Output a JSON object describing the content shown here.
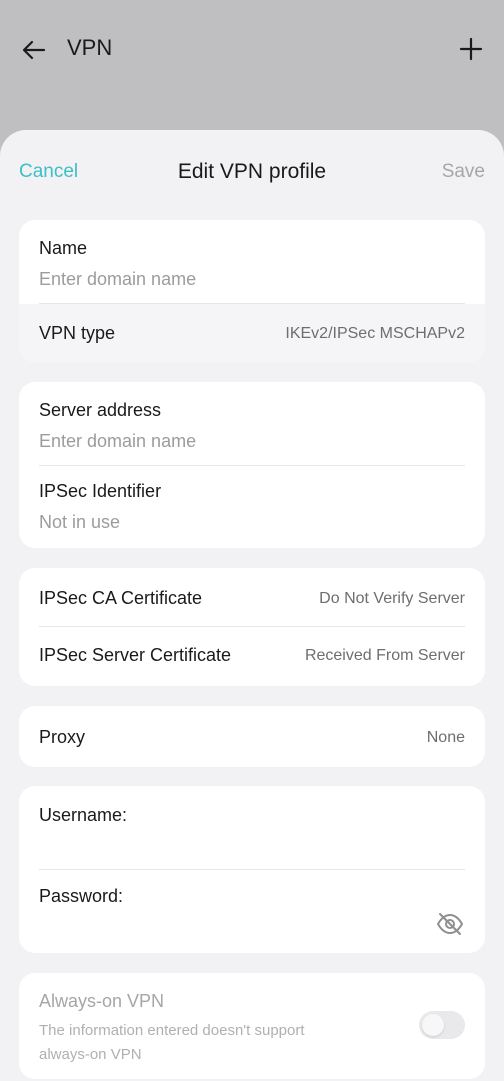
{
  "topbar": {
    "title": "VPN"
  },
  "sheet": {
    "cancel": "Cancel",
    "title": "Edit VPN profile",
    "save": "Save"
  },
  "profile": {
    "name_label": "Name",
    "name_placeholder": "Enter domain name",
    "vpn_type_label": "VPN type",
    "vpn_type_value": "IKEv2/IPSec MSCHAPv2"
  },
  "server": {
    "address_label": "Server address",
    "address_placeholder": "Enter domain name",
    "identifier_label": "IPSec Identifier",
    "identifier_placeholder": "Not in use"
  },
  "certificates": {
    "ca_label": "IPSec CA Certificate",
    "ca_value": "Do Not Verify Server",
    "server_label": "IPSec Server Certificate",
    "server_value": "Received From Server"
  },
  "proxy": {
    "label": "Proxy",
    "value": "None"
  },
  "credentials": {
    "username_label": "Username:",
    "password_label": "Password:"
  },
  "always_on": {
    "label": "Always-on VPN",
    "description_line1": "The information entered doesn't support",
    "description_line2": "always-on VPN",
    "enabled": false
  },
  "colors": {
    "accent": "#3cbfc7",
    "disabled_text": "#a6a6a6"
  }
}
